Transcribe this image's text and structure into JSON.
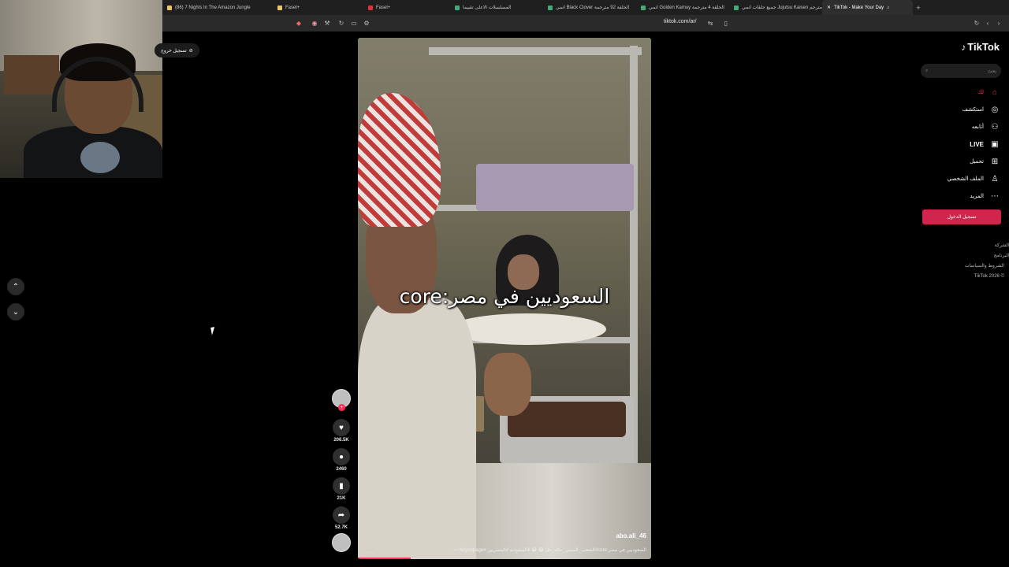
{
  "browser": {
    "tabs": [
      {
        "label": "(86) 7 Nights In The Amazon Jungle",
        "color": "#e9c46a"
      },
      {
        "label": "Fasel+",
        "color": "#e9c46a"
      },
      {
        "label": "Fasel+",
        "color": "#d33"
      },
      {
        "label": "المسلسلات الاعلى تقييما",
        "color": "#4a7"
      },
      {
        "label": "انمي Black Clover الحلقة 92 مترجمة",
        "color": "#4a7"
      },
      {
        "label": "انمي Golden Kamuy الحلقة 4 مترجمة",
        "color": "#4a7"
      },
      {
        "label": "جميع حلقات انمي Jujutsu Kaisen مترجم",
        "color": "#4a7"
      },
      {
        "label": "TikTok - Make Your Day",
        "color": "#fff"
      }
    ],
    "url": "tiktok.com/ar/"
  },
  "left_pill": "تسجيل خروج",
  "video": {
    "caption": "السعوديين في مصر:core",
    "username": "abo.ali_46",
    "description": "السعوديين في مصر:core#الشعب_الصيني_ماله_حل 😂 😂 #السعوديه #المصريين #foryoupage —",
    "more_label": "المزيد",
    "progress": 0.18
  },
  "actions": {
    "likes": "206.5K",
    "comments": "2460",
    "saves": "21K",
    "shares": "52.7K"
  },
  "sidebar": {
    "logo": "TikTok",
    "search_placeholder": "بحث",
    "nav": [
      {
        "label": "لك",
        "icon": "home-icon",
        "glyph": "⌂"
      },
      {
        "label": "استكشف",
        "icon": "compass-icon",
        "glyph": "◎"
      },
      {
        "label": "أتابعه",
        "icon": "following-icon",
        "glyph": "⚇"
      },
      {
        "label": "LIVE",
        "icon": "live-icon",
        "glyph": "▣"
      },
      {
        "label": "تحميل",
        "icon": "upload-icon",
        "glyph": "⊞"
      },
      {
        "label": "الملف الشخصي",
        "icon": "profile-icon",
        "glyph": "♙"
      },
      {
        "label": "المزيد",
        "icon": "more-icon",
        "glyph": "⋯"
      }
    ],
    "login_label": "تسجيل الدخول",
    "footer": [
      "الشركة",
      "البرنامج",
      "الشروط والسياسات",
      "© 2026 TikTok"
    ]
  }
}
